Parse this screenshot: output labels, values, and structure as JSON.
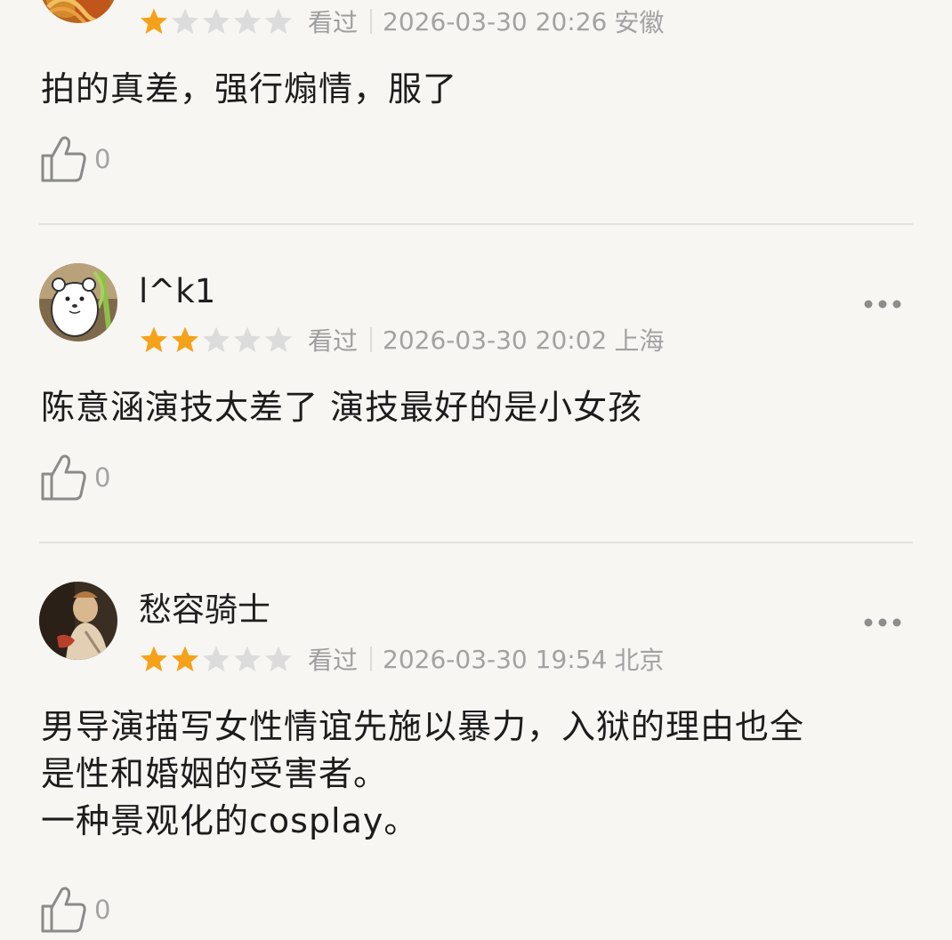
{
  "colors": {
    "background": "#f7f6f2",
    "star_filled": "#f5a21b",
    "star_empty": "#dcdcdc",
    "meta_text": "#a2a2a2",
    "divider": "#e2e1dd"
  },
  "reviews": [
    {
      "username": "",
      "rating": 1,
      "max_rating": 5,
      "status": "看过",
      "datetime": "2026-03-30 20:26",
      "location": "安徽",
      "content": [
        "拍的真差，强行煽情，服了"
      ],
      "likes": "0",
      "avatar_icon": "food-photo-avatar"
    },
    {
      "username": "l^k1",
      "rating": 2,
      "max_rating": 5,
      "status": "看过",
      "datetime": "2026-03-30 20:02",
      "location": "上海",
      "content": [
        "陈意涵演技太差了 演技最好的是小女孩"
      ],
      "likes": "0",
      "avatar_icon": "cartoon-weasel-avatar"
    },
    {
      "username": "愁容骑士",
      "rating": 2,
      "max_rating": 5,
      "status": "看过",
      "datetime": "2026-03-30 19:54",
      "location": "北京",
      "content": [
        "男导演描写女性情谊先施以暴力，入狱的理由也全",
        "是性和婚姻的受害者。",
        "一种景观化的cosplay。"
      ],
      "likes": "0",
      "avatar_icon": "classical-painting-avatar"
    }
  ],
  "icons": {
    "more": "more-options-icon",
    "like": "thumbs-up-icon",
    "star": "star-icon"
  }
}
